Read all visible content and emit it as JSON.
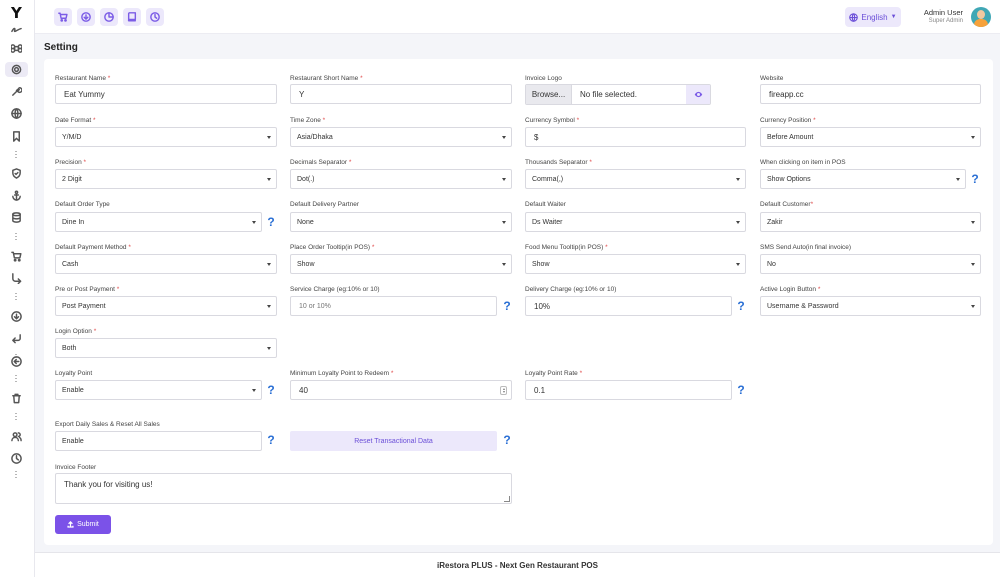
{
  "app": {
    "logo": "Y"
  },
  "header": {
    "icons": [
      "cart-icon",
      "download-icon",
      "pie-chart-icon",
      "book-icon",
      "clock-icon"
    ],
    "language": "English",
    "user_name": "Admin User",
    "user_role": "Super Admin"
  },
  "sidebar": {
    "icons": [
      "signature-icon",
      "command-icon",
      "gear-icon",
      "wrench-icon",
      "globe-icon",
      "bookmark-icon",
      "more-icon",
      "shield-icon",
      "anchor-icon",
      "database-icon",
      "more-icon",
      "cart-icon",
      "share-icon",
      "more-icon",
      "download-icon",
      "return-icon",
      "more-icon",
      "back-icon",
      "more-icon",
      "trash-icon",
      "more-icon",
      "users-icon",
      "clock-icon",
      "more-icon"
    ]
  },
  "page": {
    "title": "Setting"
  },
  "form": {
    "restaurant_name": {
      "label": "Restaurant Name",
      "required": "*",
      "value": "Eat Yummy"
    },
    "restaurant_short_name": {
      "label": "Restaurant Short Name",
      "required": "*",
      "value": "Y"
    },
    "invoice_logo": {
      "label": "Invoice Logo",
      "browse": "Browse...",
      "file_status": "No file selected."
    },
    "website": {
      "label": "Website",
      "value": "fireapp.cc"
    },
    "date_format": {
      "label": "Date Format",
      "required": "*",
      "value": "Y/M/D"
    },
    "time_zone": {
      "label": "Time Zone",
      "required": "*",
      "value": "Asia/Dhaka"
    },
    "currency_symbol": {
      "label": "Currency Symbol",
      "required": "*",
      "value": "$"
    },
    "currency_position": {
      "label": "Currency Position",
      "required": "*",
      "value": "Before Amount"
    },
    "precision": {
      "label": "Precision",
      "required": "*",
      "value": "2 Digit"
    },
    "decimals_separator": {
      "label": "Decimals Separator",
      "required": "*",
      "value": "Dot(.)"
    },
    "thousands_separator": {
      "label": "Thousands Separator",
      "required": "*",
      "value": "Comma(,)"
    },
    "pos_click": {
      "label": "When clicking on item in POS",
      "value": "Show Options"
    },
    "default_order_type": {
      "label": "Default Order Type",
      "value": "Dine In"
    },
    "default_delivery_partner": {
      "label": "Default Delivery Partner",
      "value": "None"
    },
    "default_waiter": {
      "label": "Default Waiter",
      "value": "Ds Waiter"
    },
    "default_customer": {
      "label": "Default Customer",
      "required": "*",
      "value": "Zakir"
    },
    "default_payment_method": {
      "label": "Default Payment Method",
      "required": "*",
      "value": "Cash"
    },
    "place_order_tooltip": {
      "label": "Place Order Tooltip(in POS)",
      "required": "*",
      "value": "Show"
    },
    "food_menu_tooltip": {
      "label": "Food Menu Tooltip(in POS)",
      "required": "*",
      "value": "Show"
    },
    "sms_send_auto": {
      "label": "SMS Send Auto(in final invoice)",
      "value": "No"
    },
    "pre_post_payment": {
      "label": "Pre or Post Payment",
      "required": "*",
      "value": "Post Payment"
    },
    "service_charge": {
      "label": "Service Charge (eg:10% or 10)",
      "placeholder": "10 or 10%"
    },
    "delivery_charge": {
      "label": "Delivery Charge (eg:10% or 10)",
      "value": "10%"
    },
    "active_login_button": {
      "label": "Active Login Button",
      "required": "*",
      "value": "Username & Password"
    },
    "login_option": {
      "label": "Login Option",
      "required": "*",
      "value": "Both"
    },
    "loyalty_point": {
      "label": "Loyalty Point",
      "value": "Enable"
    },
    "min_loyalty_redeem": {
      "label": "Minimum Loyalty Point to Redeem",
      "required": "*",
      "value": "40"
    },
    "loyalty_point_rate": {
      "label": "Loyalty Point Rate",
      "required": "*",
      "value": "0.1"
    },
    "export_daily_sales": {
      "label": "Export Daily Sales & Reset All Sales",
      "value": "Enable"
    },
    "reset_button": "Reset Transactional Data",
    "invoice_footer": {
      "label": "Invoice Footer",
      "value": "Thank you for visiting us!"
    },
    "help_mark": "?",
    "submit": "Submit"
  },
  "footer": {
    "text": "iRestora PLUS - Next Gen Restaurant POS"
  },
  "colors": {
    "accent": "#7b52e8",
    "accent_light": "#ece8fb",
    "help": "#2a6fd4",
    "required": "#e04848"
  }
}
